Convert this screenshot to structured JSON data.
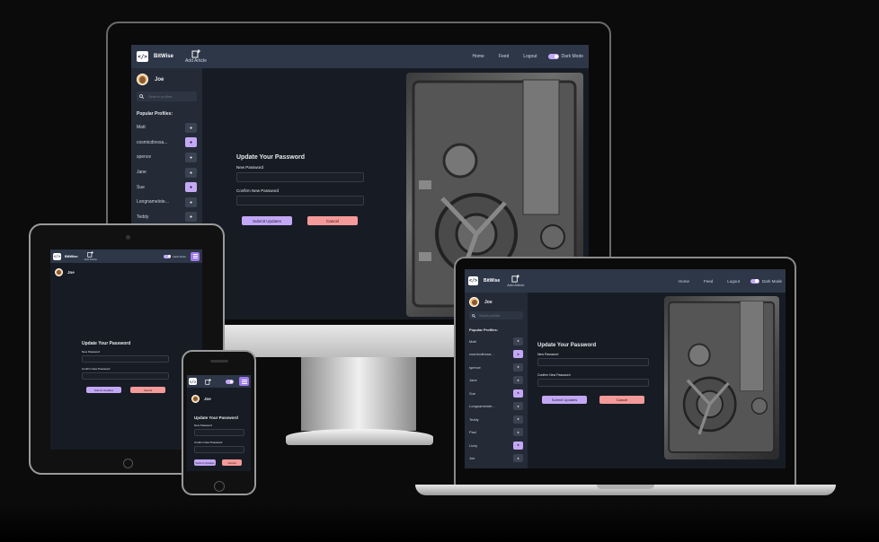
{
  "app": {
    "brand": "BitWise",
    "add_article": "Add Article",
    "logo_glyph": "</>",
    "nav": {
      "home": "Home",
      "feed": "Feed",
      "logout": "Logout",
      "dark_mode": "Dark Mode"
    },
    "user": {
      "name": "Joe"
    },
    "search": {
      "placeholder": "Search profiles"
    },
    "popular_title": "Popular Profiles:",
    "profiles_desktop": [
      {
        "name": "Matt",
        "active": false
      },
      {
        "name": "cosmicdinosa...",
        "active": true
      },
      {
        "name": "spence",
        "active": false
      },
      {
        "name": "Jane",
        "active": false
      },
      {
        "name": "Sue",
        "active": true
      },
      {
        "name": "Longnamelote...",
        "active": false
      },
      {
        "name": "Teddy",
        "active": false
      }
    ],
    "profiles_laptop": [
      {
        "name": "Matt",
        "active": false
      },
      {
        "name": "cosmicdinosa...",
        "active": true
      },
      {
        "name": "spence",
        "active": false
      },
      {
        "name": "Jane",
        "active": false
      },
      {
        "name": "Sue",
        "active": true
      },
      {
        "name": "Longnamelote...",
        "active": false
      },
      {
        "name": "Teddy",
        "active": false
      },
      {
        "name": "Paul",
        "active": false
      },
      {
        "name": "Lizzy",
        "active": true
      },
      {
        "name": "Joe",
        "active": false
      }
    ],
    "form": {
      "title": "Update Your Password",
      "new_password_label": "New Password",
      "confirm_password_label": "Confirm New Password",
      "submit": "Submit Updates",
      "cancel": "Cancel"
    }
  },
  "icons": {
    "logo": "code-brackets-icon",
    "add_article": "document-plus-icon",
    "search": "magnifier-icon",
    "follow": "follow-user-icon",
    "menu": "hamburger-icon",
    "hero": "vault-door-image"
  },
  "colors": {
    "navbar": "#2d3748",
    "sidebar": "#242b37",
    "main": "#171c24",
    "accent": "#c3a8f5",
    "cancel": "#f59a9a"
  }
}
